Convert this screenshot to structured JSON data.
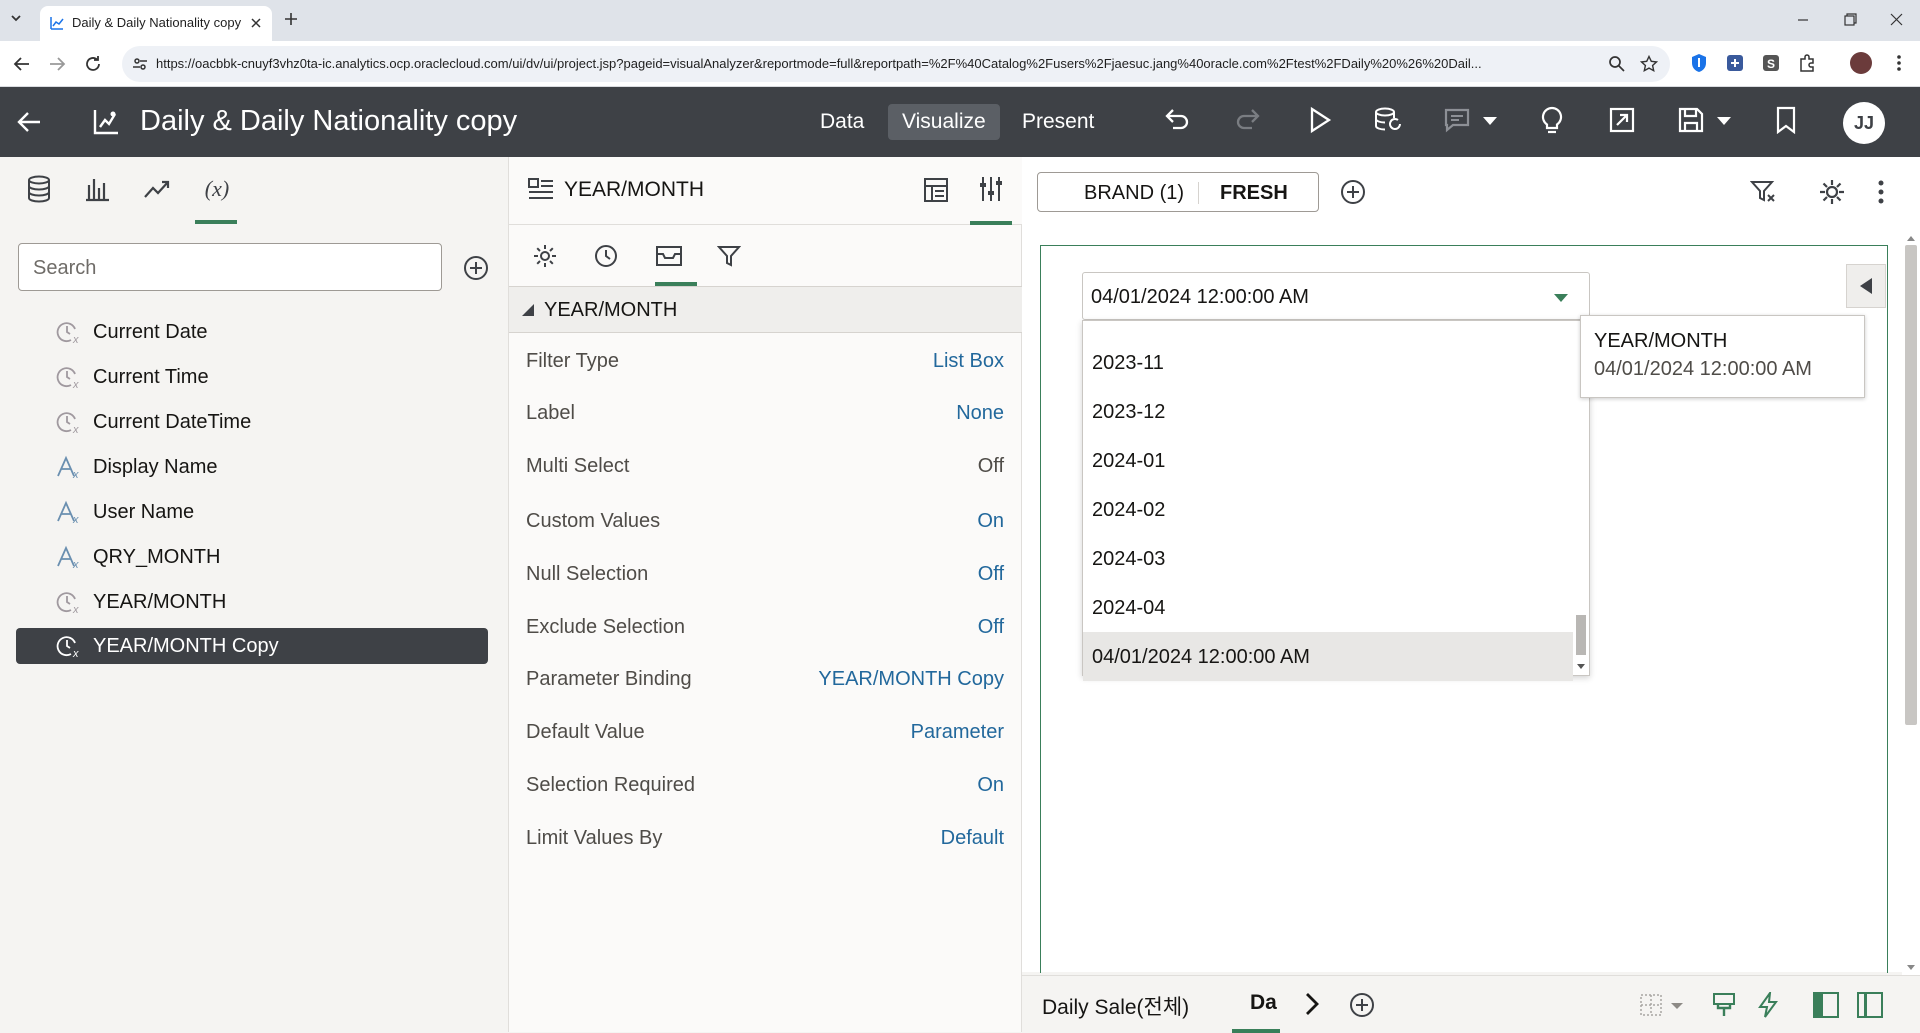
{
  "browser": {
    "tab_title": "Daily & Daily Nationality copy",
    "url": "https://oacbbk-cnuyf3vhz0ta-ic.analytics.ocp.oraclecloud.com/ui/dv/ui/project.jsp?pageid=visualAnalyzer&reportmode=full&reportpath=%2F%40Catalog%2Fusers%2Fjaesuc.jang%40oracle.com%2Ftest%2FDaily%20%26%20Dail..."
  },
  "header": {
    "title": "Daily & Daily Nationality copy",
    "nav": [
      "Data",
      "Visualize",
      "Present"
    ],
    "active_nav": "Visualize",
    "avatar_initials": "JJ"
  },
  "left_panel": {
    "search_placeholder": "Search",
    "items": [
      {
        "label": "Current Date",
        "icon": "datetime-expression-icon"
      },
      {
        "label": "Current Time",
        "icon": "datetime-expression-icon"
      },
      {
        "label": "Current DateTime",
        "icon": "datetime-expression-icon"
      },
      {
        "label": "Display Name",
        "icon": "text-expression-icon"
      },
      {
        "label": "User Name",
        "icon": "text-expression-icon"
      },
      {
        "label": "QRY_MONTH",
        "icon": "text-expression-icon"
      },
      {
        "label": "YEAR/MONTH",
        "icon": "datetime-expression-icon"
      },
      {
        "label": "YEAR/MONTH Copy",
        "icon": "datetime-expression-icon",
        "selected": true
      }
    ]
  },
  "properties": {
    "title": "YEAR/MONTH",
    "section": "YEAR/MONTH",
    "rows": [
      {
        "label": "Filter Type",
        "value": "List Box"
      },
      {
        "label": "Label",
        "value": "None"
      },
      {
        "label": "Multi Select",
        "value": "Off"
      },
      {
        "label": "Custom Values",
        "value": "On"
      },
      {
        "label": "Null Selection",
        "value": "Off"
      },
      {
        "label": "Exclude Selection",
        "value": "Off"
      },
      {
        "label": "Parameter Binding",
        "value": "YEAR/MONTH Copy"
      },
      {
        "label": "Default Value",
        "value": "Parameter"
      },
      {
        "label": "Selection Required",
        "value": "On"
      },
      {
        "label": "Limit Values By",
        "value": "Default"
      }
    ]
  },
  "filter_bar": {
    "brand_label": "BRAND (1)",
    "brand_value": "FRESH"
  },
  "list_box": {
    "input_value": "04/01/2024 12:00:00 AM",
    "options": [
      "2023-11",
      "2023-12",
      "2024-01",
      "2024-02",
      "2024-03",
      "2024-04",
      "04/01/2024 12:00:00 AM"
    ],
    "selected": "04/01/2024 12:00:00 AM"
  },
  "tooltip": {
    "title": "YEAR/MONTH",
    "value": "04/01/2024 12:00:00 AM"
  },
  "canvas_tabs": [
    "Daily Sale(전체)",
    "Da"
  ],
  "colors": {
    "accent_green": "#3a7f5a",
    "header_bg": "#3e4146",
    "link_blue": "#22689c"
  }
}
